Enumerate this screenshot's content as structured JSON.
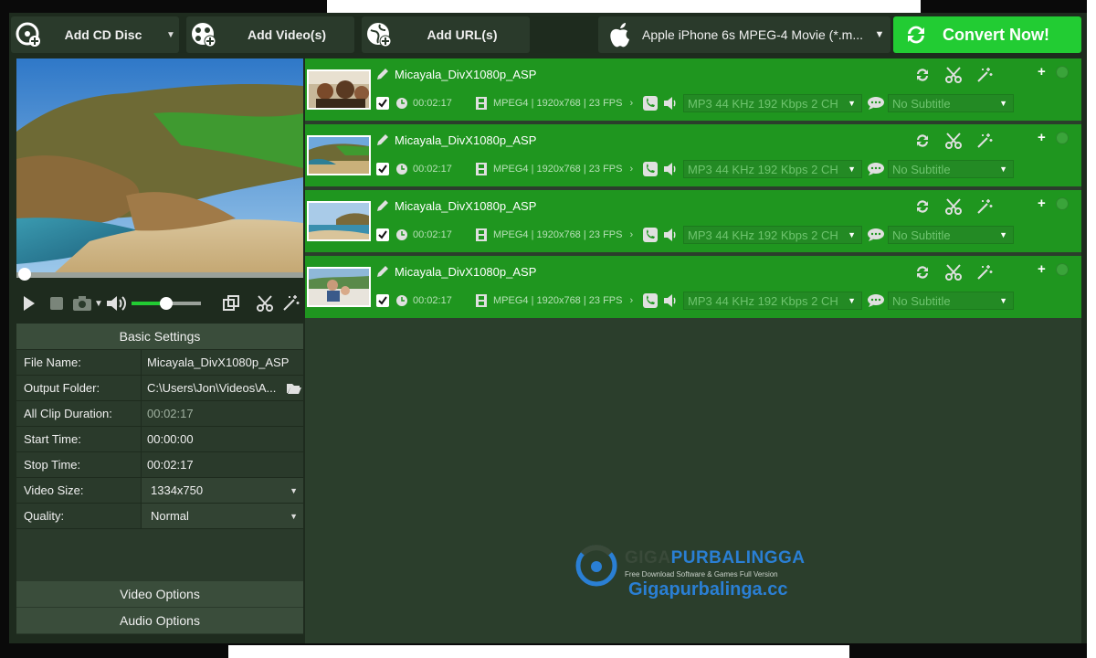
{
  "toolbar": {
    "add_cd": {
      "label": "Add CD Disc",
      "icon": "disc-add-icon"
    },
    "add_video": {
      "label": "Add Video(s)",
      "icon": "film-reel-add-icon"
    },
    "add_url": {
      "label": "Add URL(s)",
      "icon": "globe-add-icon"
    },
    "profile": {
      "label": "Apple iPhone 6s MPEG-4 Movie (*.m...",
      "icon": "apple-icon"
    },
    "convert": {
      "label": "Convert Now!",
      "icon": "refresh-icon"
    }
  },
  "player": {
    "seek_progress": 0,
    "volume_level": 0.5
  },
  "settings": {
    "header": "Basic Settings",
    "rows": [
      {
        "key": "File Name:",
        "value": "Micayala_DivX1080p_ASP"
      },
      {
        "key": "Output Folder:",
        "value": "C:\\Users\\Jon\\Videos\\A..."
      },
      {
        "key": "All Clip Duration:",
        "value": "00:02:17"
      },
      {
        "key": "Start Time:",
        "value": "00:00:00"
      },
      {
        "key": "Stop Time:",
        "value": "00:02:17"
      },
      {
        "key": "Video Size:",
        "value": "1334x750"
      },
      {
        "key": "Quality:",
        "value": "Normal"
      }
    ],
    "video_options": "Video Options",
    "audio_options": "Audio Options"
  },
  "files": [
    {
      "name": "Micayala_DivX1080p_ASP",
      "duration": "00:02:17",
      "format": "MPEG4 | 1920x768 | 23 FPS",
      "audio": "MP3 44 KHz 192 Kbps 2 CH",
      "subtitle": "No Subtitle",
      "checked": true
    },
    {
      "name": "Micayala_DivX1080p_ASP",
      "duration": "00:02:17",
      "format": "MPEG4 | 1920x768 | 23 FPS",
      "audio": "MP3 44 KHz 192 Kbps 2 CH",
      "subtitle": "No Subtitle",
      "checked": true
    },
    {
      "name": "Micayala_DivX1080p_ASP",
      "duration": "00:02:17",
      "format": "MPEG4 | 1920x768 | 23 FPS",
      "audio": "MP3 44 KHz 192 Kbps 2 CH",
      "subtitle": "No Subtitle",
      "checked": true
    },
    {
      "name": "Micayala_DivX1080p_ASP",
      "duration": "00:02:17",
      "format": "MPEG4 | 1920x768 | 23 FPS",
      "audio": "MP3 44 KHz 192 Kbps 2 CH",
      "subtitle": "No Subtitle",
      "checked": true
    }
  ],
  "watermark": {
    "brand_a": "GIGA",
    "brand_b": "PURBALINGGA",
    "tagline": "Free Download Software & Games Full Version",
    "url": "Gigapurbalinga.cc"
  },
  "colors": {
    "background": "#1e2b1e",
    "panel": "#2a3a2b",
    "accent_green": "#22cc33",
    "row_green": "#1f961f"
  }
}
